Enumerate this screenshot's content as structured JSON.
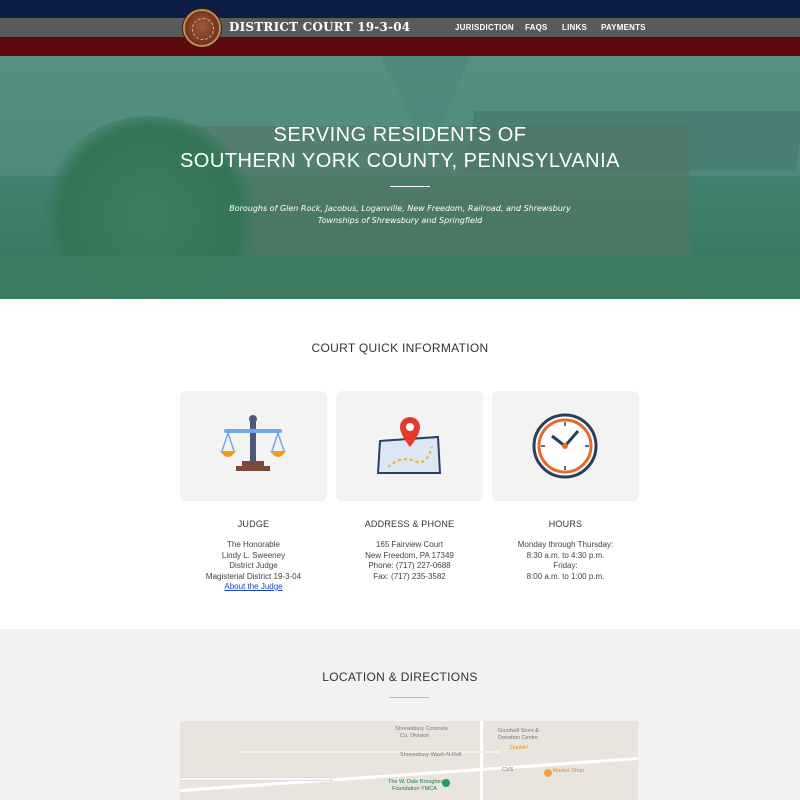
{
  "header": {
    "site_title": "DISTRICT COURT 19-3-04",
    "nav": [
      "JURISDICTION",
      "FAQS",
      "LINKS",
      "PAYMENTS"
    ]
  },
  "hero": {
    "line1": "SERVING RESIDENTS OF",
    "line2": "SOUTHERN YORK COUNTY, PENNSYLVANIA",
    "sub1": "Boroughs of Glen Rock, Jacobus, Loganville, New Freedom, Railroad, and Shrewsbury",
    "sub2": "Townships of Shrewsbury and Springfield"
  },
  "quick_info": {
    "title": "COURT QUICK INFORMATION",
    "judge": {
      "heading": "JUDGE",
      "lines": [
        "The Honorable",
        "Lindy L. Sweeney",
        "District Judge",
        "Magisterial District 19-3-04"
      ],
      "link": "About the Judge",
      "icon": "scales-of-justice-icon"
    },
    "address": {
      "heading": "ADDRESS & PHONE",
      "lines": [
        "165 Fairview Court",
        "New Freedom, PA 17349",
        "Phone: (717) 227-0688",
        "Fax: (717) 235-3582"
      ],
      "icon": "map-pin-icon"
    },
    "hours": {
      "heading": "HOURS",
      "lines": [
        "Monday through Thursday:",
        "8:30 a.m. to 4:30 p.m.",
        "Friday:",
        "8:00 a.m. to 1:00 p.m."
      ],
      "icon": "clock-icon"
    }
  },
  "location": {
    "title": "LOCATION & DIRECTIONS",
    "map_labels": {
      "concrete": "Shrewsbury Concrete",
      "concrete2": "Co. Division",
      "goodwill": "Goodwill Store &",
      "goodwill2": "Donation Center",
      "dunkin": "Dunkin'",
      "wash": "Shrewsbury Wash-N-Roll",
      "cvs": "CVS",
      "market": "Market Shop",
      "ymca": "The W. Dale Brougher",
      "ymca2": "Foundation YMCA"
    }
  },
  "colors": {
    "top_band": "#0c1e44",
    "nav_band": "#5a5a5a",
    "red_band": "#5c0a0e",
    "link": "#1a3fc4"
  }
}
